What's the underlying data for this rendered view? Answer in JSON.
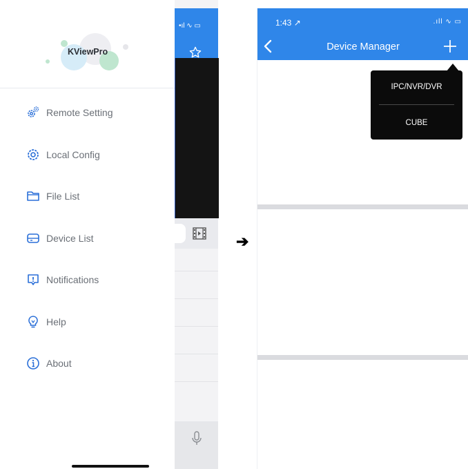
{
  "left_phone": {
    "logo_text": "KViewPro",
    "menu": [
      {
        "label": "Remote Setting",
        "icon": "remote-setting-gears-icon"
      },
      {
        "label": "Local Config",
        "icon": "local-config-gear-icon"
      },
      {
        "label": "File List",
        "icon": "folder-icon"
      },
      {
        "label": "Device List",
        "icon": "device-list-icon"
      },
      {
        "label": "Notifications",
        "icon": "notification-alert-icon"
      },
      {
        "label": "Help",
        "icon": "lightbulb-help-icon"
      },
      {
        "label": "About",
        "icon": "info-icon"
      }
    ],
    "background_status_icons": "•ıl ∿ ▭"
  },
  "arrow": "➔",
  "right_phone": {
    "status": {
      "time": "1:43 ↗",
      "icons": ".ıll ∿ ▭"
    },
    "nav_title": "Device Manager",
    "popup_items": [
      "IPC/NVR/DVR",
      "CUBE"
    ]
  },
  "colors": {
    "nav_blue": "#2f86e9",
    "icon_blue": "#2a6fd8",
    "menu_text": "#6a6f76",
    "popup_bg": "#0b0b0b"
  }
}
